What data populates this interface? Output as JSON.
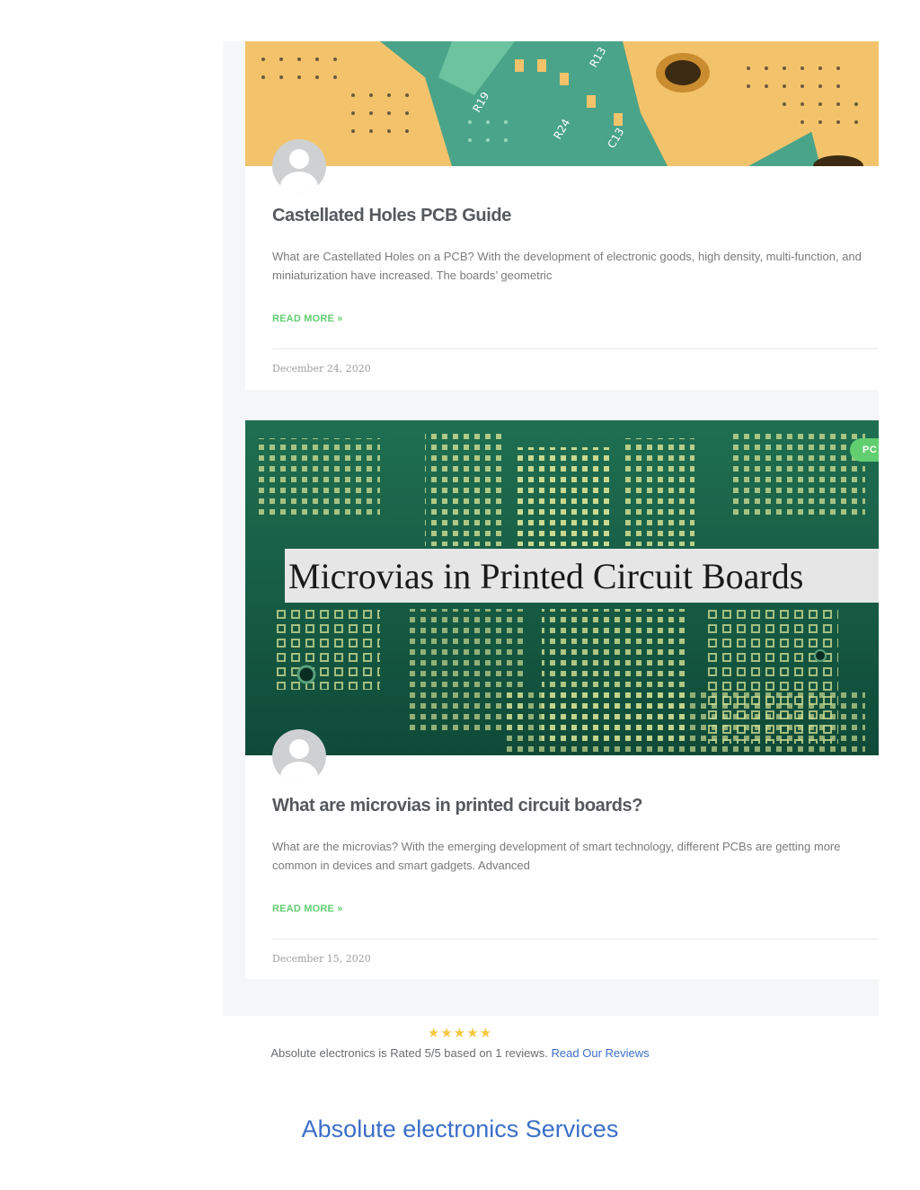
{
  "posts": [
    {
      "title": "Castellated Holes PCB Guide",
      "excerpt": "What are Castellated Holes on a PCB? With the development of electronic goods, high density, multi-function, and miniaturization have increased. The boards’ geometric",
      "read_more": "READ MORE »",
      "date": "December 24, 2020",
      "image_text": [
        "R19",
        "R24",
        "C13",
        "R13"
      ]
    },
    {
      "title": "What are microvias in printed circuit boards?",
      "excerpt": "What are the microvias?  With the emerging development of smart technology, different PCBs are getting more common in devices and smart gadgets. Advanced",
      "read_more": "READ MORE »",
      "date": "December 15, 2020",
      "badge": "PC",
      "image_caption": "Microvias in Printed Circuit Boards"
    }
  ],
  "rating": {
    "stars": "★★★★★",
    "text": "Absolute electronics is Rated 5/5 based on 1 reviews.",
    "link": "Read Our Reviews"
  },
  "services_heading": "Absolute electronics Services",
  "colors": {
    "accent_green": "#61ce70",
    "link_blue": "#3b6fc9",
    "star_yellow": "#f5c842",
    "panel_bg": "#f5f6f8"
  },
  "icons": [
    "avatar-placeholder-icon",
    "star-icon"
  ]
}
